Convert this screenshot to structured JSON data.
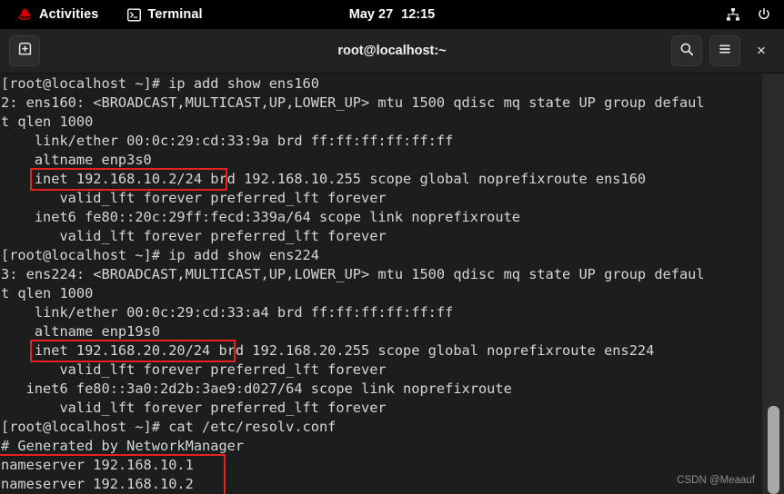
{
  "top_panel": {
    "activities_label": "Activities",
    "app_label": "Terminal",
    "clock_date": "May 27",
    "clock_time": "12:15",
    "tray": {
      "network_icon": "network-wired-icon",
      "power_icon": "power-icon"
    }
  },
  "window": {
    "title": "root@localhost:~",
    "new_tab_icon": "new-tab-icon",
    "search_icon": "search-icon",
    "menu_icon": "hamburger-menu-icon",
    "close_label": "×"
  },
  "terminal": {
    "lines": [
      "[root@localhost ~]# ip add show ens160",
      "2: ens160: <BROADCAST,MULTICAST,UP,LOWER_UP> mtu 1500 qdisc mq state UP group defaul",
      "t qlen 1000",
      "    link/ether 00:0c:29:cd:33:9a brd ff:ff:ff:ff:ff:ff",
      "    altname enp3s0",
      "    inet 192.168.10.2/24 brd 192.168.10.255 scope global noprefixroute ens160",
      "       valid_lft forever preferred_lft forever",
      "    inet6 fe80::20c:29ff:fecd:339a/64 scope link noprefixroute",
      "       valid_lft forever preferred_lft forever",
      "[root@localhost ~]# ip add show ens224",
      "3: ens224: <BROADCAST,MULTICAST,UP,LOWER_UP> mtu 1500 qdisc mq state UP group defaul",
      "t qlen 1000",
      "    link/ether 00:0c:29:cd:33:a4 brd ff:ff:ff:ff:ff:ff",
      "    altname enp19s0",
      "    inet 192.168.20.20/24 brd 192.168.20.255 scope global noprefixroute ens224",
      "       valid_lft forever preferred_lft forever",
      "   inet6 fe80::3a0:2d2b:3ae9:d027/64 scope link noprefixroute",
      "       valid_lft forever preferred_lft forever",
      "[root@localhost ~]# cat /etc/resolv.conf",
      "# Generated by NetworkManager",
      "nameserver 192.168.10.1",
      "nameserver 192.168.10.2"
    ],
    "highlight_color": "#e8201e",
    "highlights": [
      {
        "name": "inet-ens160-highlight",
        "text": "inet 192.168.10.2/24"
      },
      {
        "name": "inet-ens224-highlight",
        "text": "inet 192.168.20.20/24"
      },
      {
        "name": "nameserver-highlight",
        "text": "nameserver 192.168.10.1 / nameserver 192.168.10.2"
      }
    ]
  },
  "watermark": {
    "text": "CSDN @Meaauf"
  }
}
